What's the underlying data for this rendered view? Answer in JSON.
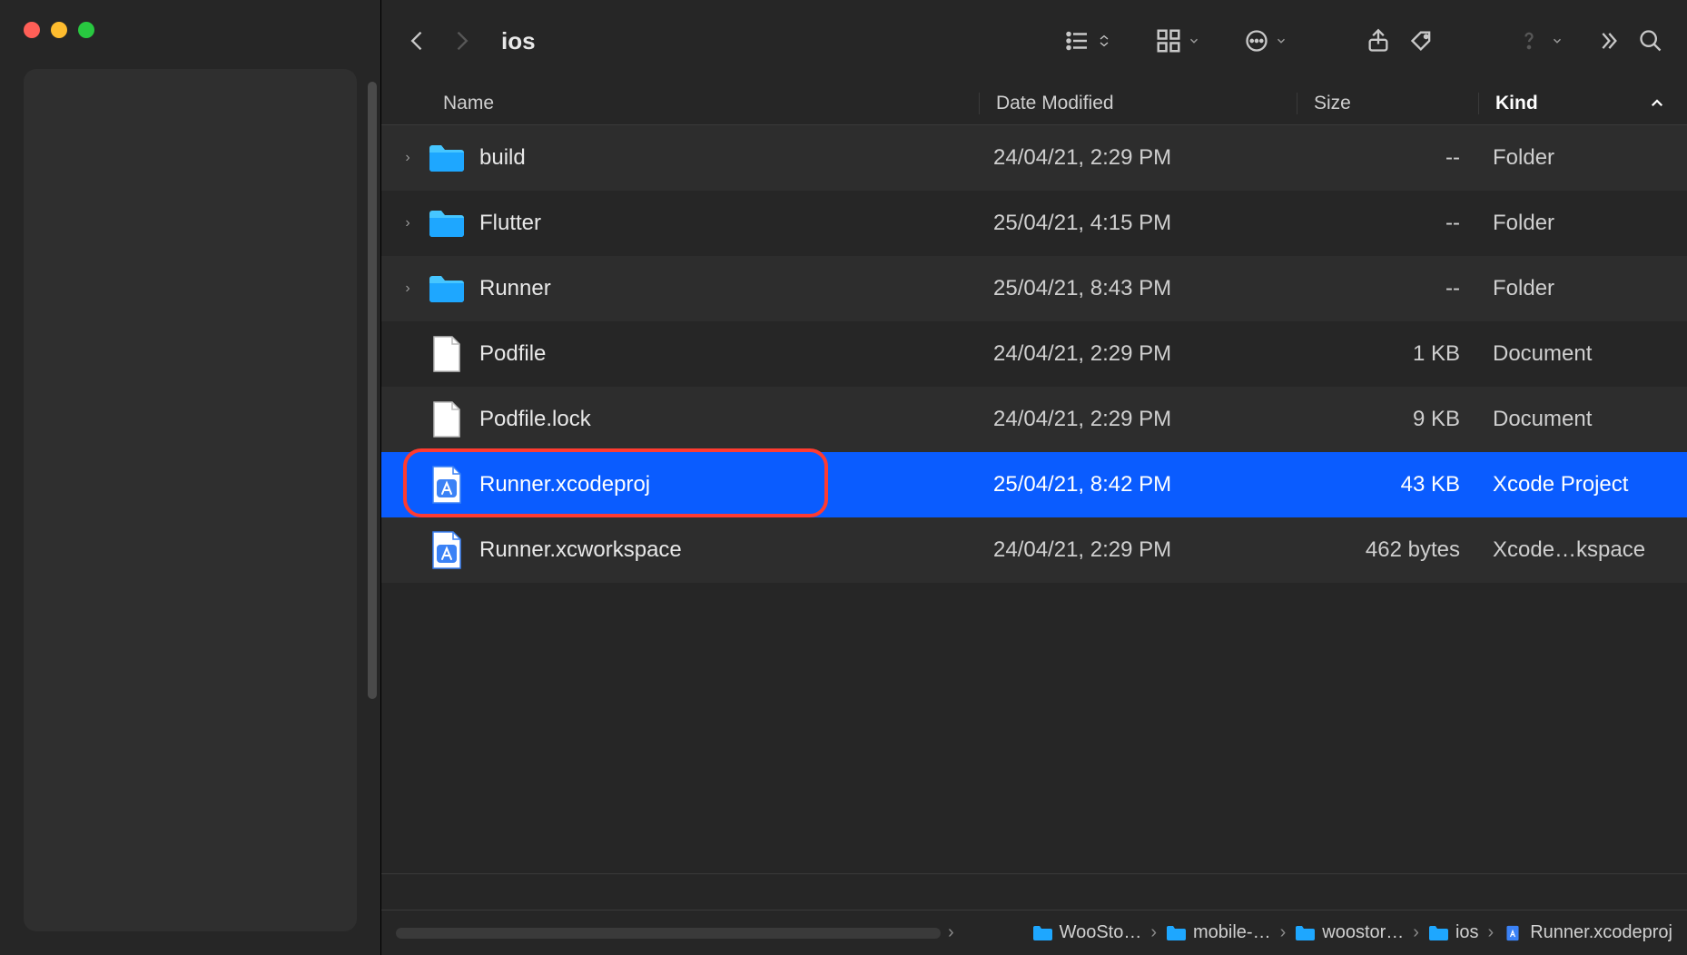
{
  "window": {
    "title": "ios"
  },
  "columns": {
    "name": "Name",
    "date": "Date Modified",
    "size": "Size",
    "kind": "Kind"
  },
  "files": [
    {
      "name": "build",
      "date": "24/04/21, 2:29 PM",
      "size": "--",
      "kind": "Folder",
      "icon": "folder",
      "expandable": true
    },
    {
      "name": "Flutter",
      "date": "25/04/21, 4:15 PM",
      "size": "--",
      "kind": "Folder",
      "icon": "folder",
      "expandable": true
    },
    {
      "name": "Runner",
      "date": "25/04/21, 8:43 PM",
      "size": "--",
      "kind": "Folder",
      "icon": "folder",
      "expandable": true
    },
    {
      "name": "Podfile",
      "date": "24/04/21, 2:29 PM",
      "size": "1 KB",
      "kind": "Document",
      "icon": "doc",
      "expandable": false
    },
    {
      "name": "Podfile.lock",
      "date": "24/04/21, 2:29 PM",
      "size": "9 KB",
      "kind": "Document",
      "icon": "doc",
      "expandable": false
    },
    {
      "name": "Runner.xcodeproj",
      "date": "25/04/21, 8:42 PM",
      "size": "43 KB",
      "kind": "Xcode Project",
      "icon": "xcode",
      "expandable": false,
      "selected": true,
      "highlighted": true
    },
    {
      "name": "Runner.xcworkspace",
      "date": "24/04/21, 2:29 PM",
      "size": "462 bytes",
      "kind": "Xcode…kspace",
      "icon": "xcode",
      "expandable": false
    }
  ],
  "path": [
    {
      "label": "WooSto…",
      "icon": "folder"
    },
    {
      "label": "mobile-…",
      "icon": "folder"
    },
    {
      "label": "woostor…",
      "icon": "folder"
    },
    {
      "label": "ios",
      "icon": "folder"
    },
    {
      "label": "Runner.xcodeproj",
      "icon": "xcode"
    }
  ]
}
